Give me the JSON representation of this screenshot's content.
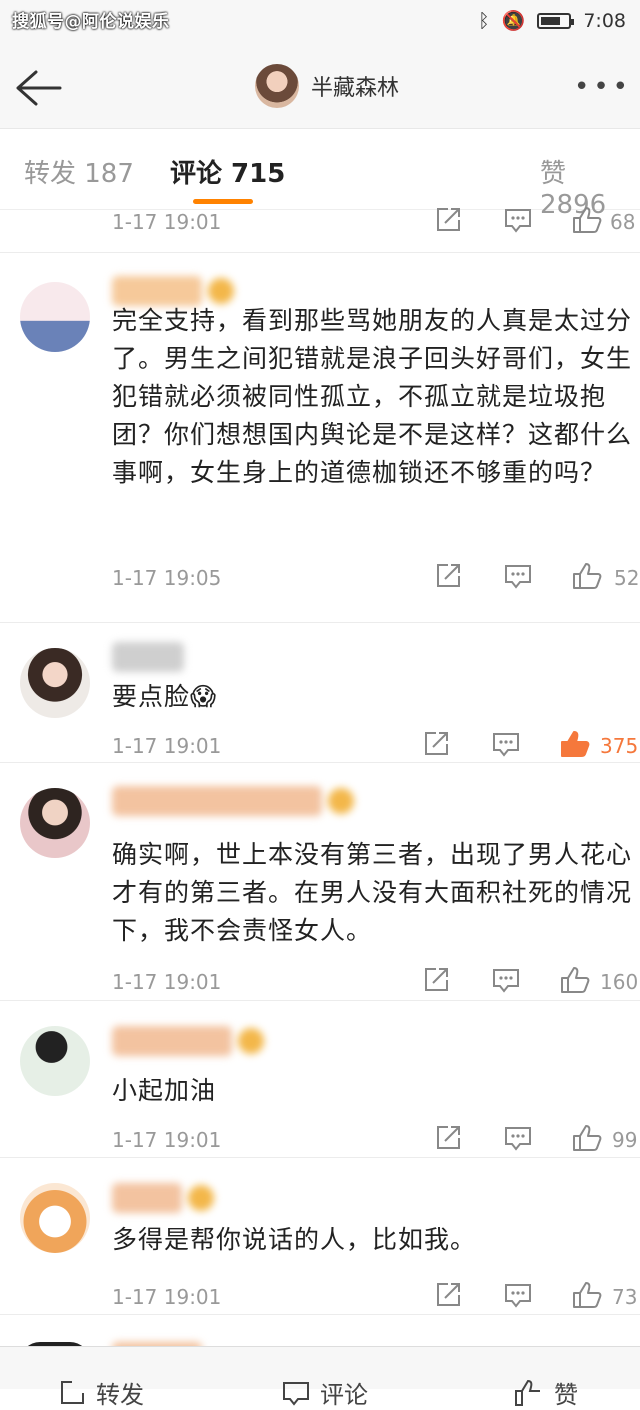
{
  "status_bar": {
    "watermark": "搜狐号@阿伦说娱乐",
    "time": "7:08",
    "battery_level": 0.7
  },
  "header": {
    "title": "半藏森林"
  },
  "tabs": [
    {
      "label": "转发 187"
    },
    {
      "label": "评论 715"
    },
    {
      "label": "赞 2896"
    }
  ],
  "comments": [
    {
      "text": "",
      "time": "1-17 19:01",
      "likes": "68"
    },
    {
      "text": "完全支持，看到那些骂她朋友的人真是太过分了。男生之间犯错就是浪子回头好哥们，女生犯错就必须被同性孤立，不孤立就是垃圾抱团？你们想想国内舆论是不是这样？这都什么事啊，女生身上的道德枷锁还不够重的吗？",
      "time": "1-17 19:05",
      "likes": "52"
    },
    {
      "text": "要点脸",
      "emoji": "😱",
      "time": "1-17 19:01",
      "likes": "375",
      "liked": true
    },
    {
      "text": "确实啊，世上本没有第三者，出现了男人花心才有的第三者。在男人没有大面积社死的情况下，我不会责怪女人。",
      "time": "1-17 19:01",
      "likes": "160"
    },
    {
      "text": "小起加油",
      "time": "1-17 19:01",
      "likes": "99"
    },
    {
      "text": "多得是帮你说话的人，比如我。",
      "time": "1-17 19:01",
      "likes": "73"
    }
  ],
  "bottom_bar": {
    "repost": "转发",
    "comment": "评论",
    "like": "赞"
  },
  "colors": {
    "accent": "#ff8200",
    "liked": "#f5783c",
    "muted": "#999999"
  }
}
